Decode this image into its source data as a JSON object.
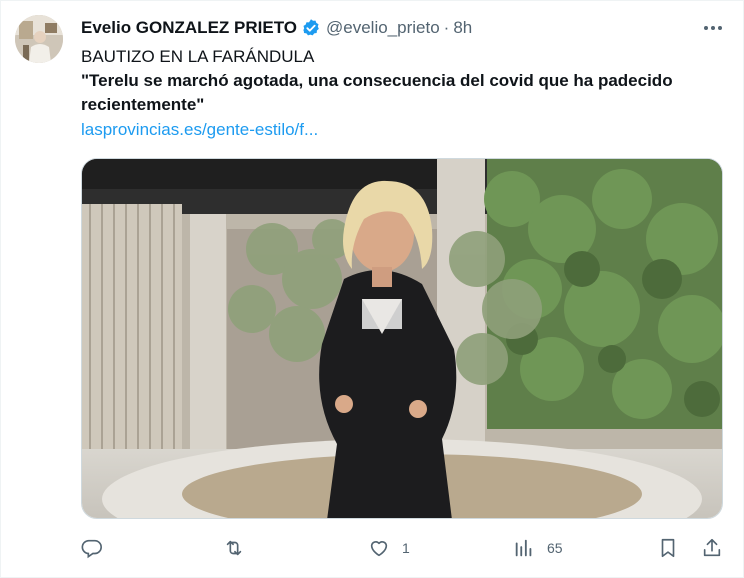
{
  "author": {
    "display_name": "Evelio GONZALEZ PRIETO",
    "handle": "@evelio_prieto",
    "separator": "·",
    "time": "8h",
    "verified": true
  },
  "tweet": {
    "line1": "BAUTIZO EN LA FARÁNDULA",
    "line2": "\"Terelu se marchó agotada, una consecuencia del covid que ha padecido recientemente\"",
    "link": "lasprovincias.es/gente-estilo/f..."
  },
  "media": {
    "description_icon": "photo"
  },
  "actions": {
    "reply": {
      "icon": "reply-icon",
      "count": ""
    },
    "retweet": {
      "icon": "retweet-icon",
      "count": ""
    },
    "like": {
      "icon": "heart-icon",
      "count": "1"
    },
    "views": {
      "icon": "views-icon",
      "count": "65"
    },
    "bookmark": {
      "icon": "bookmark-icon"
    },
    "share": {
      "icon": "share-icon"
    }
  },
  "colors": {
    "text": "#0f1419",
    "secondary": "#536471",
    "link": "#1d9bf0",
    "verified": "#1d9bf0"
  }
}
